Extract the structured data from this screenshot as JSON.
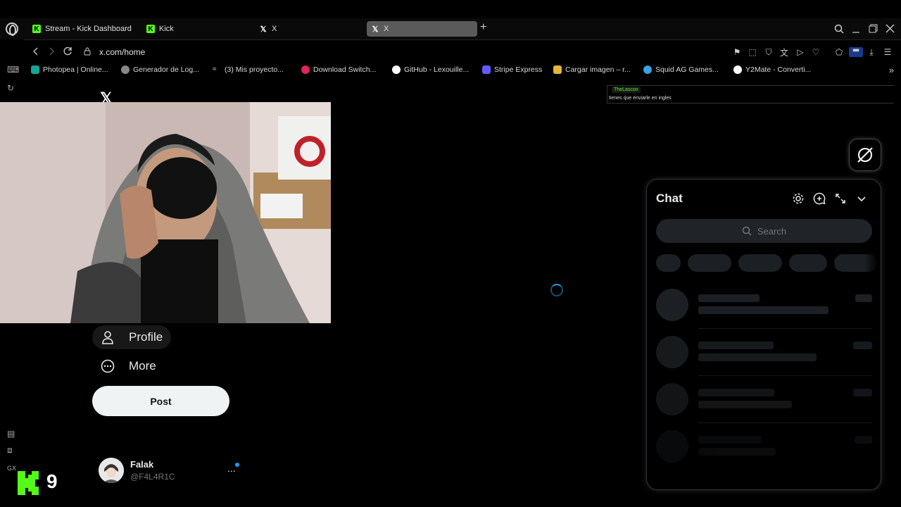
{
  "browser": {
    "tabs": [
      {
        "label": "Stream - Kick Dashboard",
        "icon": "kick-icon"
      },
      {
        "label": "Kick",
        "icon": "kick-icon"
      },
      {
        "label": "X",
        "icon": "x-icon"
      },
      {
        "label": "X",
        "icon": "x-icon",
        "active": true
      }
    ],
    "url": "x.com/home",
    "bookmarks": [
      {
        "label": "Photopea | Online...",
        "color": "#18a497"
      },
      {
        "label": "Generador de Log...",
        "color": "#888888"
      },
      {
        "label": "(3)  Mis proyecto...",
        "color": "#dddddd"
      },
      {
        "label": "Download Switch...",
        "color": "#e0245e"
      },
      {
        "label": "GitHub - Lexouille...",
        "color": "#ffffff"
      },
      {
        "label": "Stripe Express",
        "color": "#635bff"
      },
      {
        "label": "Cargar imagen – r...",
        "color": "#e8b53c"
      },
      {
        "label": "Squid AG Games...",
        "color": "#3aa0e0"
      },
      {
        "label": "Y2Mate - Converti...",
        "color": "#ffffff"
      }
    ]
  },
  "nav": {
    "profile": "Profile",
    "more": "More",
    "post": "Post"
  },
  "account": {
    "name": "Falak",
    "handle": "@F4L4R1C",
    "more": "..."
  },
  "overlay": {
    "kick_count": "9",
    "kick_user": "TheLascon",
    "kick_message": "tienes que enviarle en ingles"
  },
  "chat": {
    "title": "Chat",
    "search_placeholder": "Search"
  },
  "sidebar_label": "GX",
  "colors": {
    "kick_green": "#53fc18",
    "x_blue": "#1d9bf0",
    "background": "#000000"
  }
}
